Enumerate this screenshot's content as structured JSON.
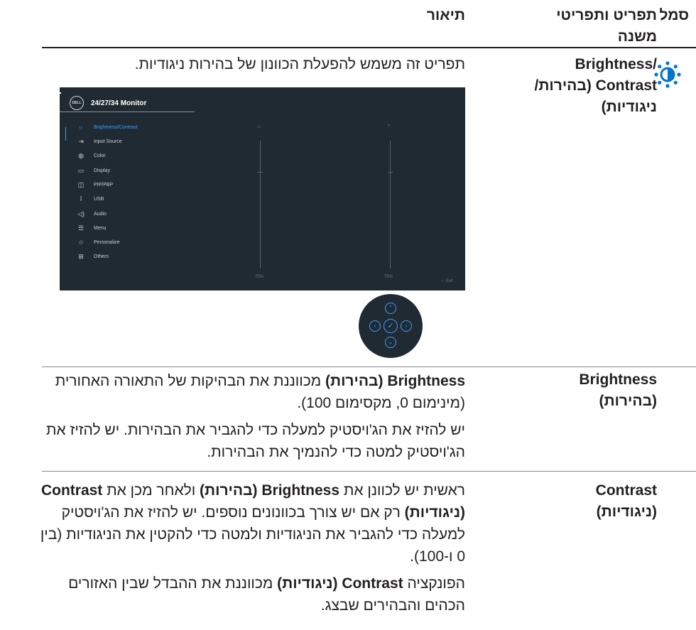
{
  "headers": {
    "symbol": "סמל",
    "menu": "תפריט ותפריטי משנה",
    "description": "תיאור"
  },
  "rows": [
    {
      "icon": "brightness-contrast-icon",
      "menu": "Brightness/ Contrast (בהירות/ ניגודיות)",
      "description": "תפריט זה משמש להפעלת הכוונון של בהירות ניגודיות."
    },
    {
      "menu": "Brightness (בהירות)",
      "para1_bold": "Brightness (בהירות)",
      "para1_rest": " מכווננת את הבהיקות של התאורה האחורית (מינימום 0, מקסימום 100).",
      "para2": "יש להזיז את הג'ויסטיק למעלה כדי להגביר את הבהירות. יש להזיז את הג'ויסטיק למטה כדי להנמיך את הבהירות."
    },
    {
      "menu": "Contrast (ניגודיות)",
      "p1_a": "ראשית יש לכוונן את ",
      "p1_b1": "Brightness (בהירות)",
      "p1_c": " ולאחר מכן את ",
      "p1_b2": "Contrast (ניגודיות)",
      "p1_d": " רק אם יש צורך בכוונונים נוספים. יש להזיז את הג'ויסטיק למעלה כדי להגביר את הניגודיות ולמטה כדי להקטין את הניגודיות (בין 0 ו-100).",
      "p2_a": "הפונקציה ",
      "p2_b": "Contrast (ניגודיות)",
      "p2_c": " מכווננת את ההבדל שבין האזורים הכהים והבהירים שבצג."
    }
  ],
  "osd": {
    "logo": "DELL",
    "title": "24/27/34 Monitor",
    "items": [
      {
        "icon": "brightness-icon",
        "label": "Brightness/Contrast",
        "active": true
      },
      {
        "icon": "input-source-icon",
        "label": "Input Source"
      },
      {
        "icon": "color-icon",
        "label": "Color"
      },
      {
        "icon": "display-icon",
        "label": "Display"
      },
      {
        "icon": "pip-pbp-icon",
        "label": "PIP/PBP"
      },
      {
        "icon": "usb-icon",
        "label": "USB"
      },
      {
        "icon": "audio-icon",
        "label": "Audio"
      },
      {
        "icon": "menu-icon",
        "label": "Menu"
      },
      {
        "icon": "personalize-icon",
        "label": "Personalize"
      },
      {
        "icon": "others-icon",
        "label": "Others"
      }
    ],
    "brightness_value": "75%",
    "contrast_value": "75%",
    "exit_label": "Exit",
    "colors": {
      "background": "#1f2a33",
      "accent": "#3aa0ff"
    }
  },
  "joystick": {
    "up_icon": "chevron-up-icon",
    "down_icon": "chevron-down-icon",
    "left_icon": "chevron-left-icon",
    "right_icon": "chevron-right-icon",
    "center_icon": "check-icon"
  }
}
